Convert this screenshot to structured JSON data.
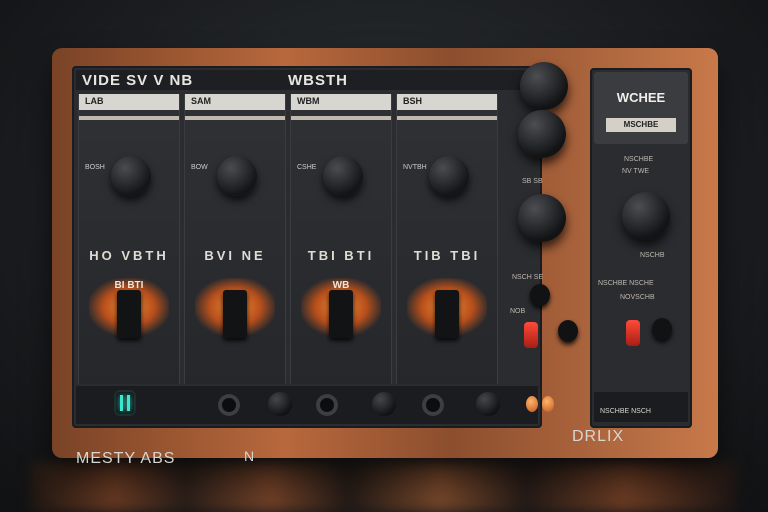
{
  "header": {
    "title_left": "VIDE SV  V  NB",
    "title_right": "WBSTH"
  },
  "channels": [
    {
      "top_label": "LAB",
      "knob_label": "BOSH",
      "readout": "HO  VBTH",
      "glow_label": "BI  BTI"
    },
    {
      "top_label": "SAM",
      "knob_label": "BOW",
      "readout": "BVI  NE",
      "glow_label": ""
    },
    {
      "top_label": "WBM",
      "knob_label": "CSHE",
      "readout": "TBI  BTI",
      "glow_label": "WB"
    },
    {
      "top_label": "BSH",
      "knob_label": "NVTBH",
      "readout": "TIB  TBI",
      "glow_label": ""
    }
  ],
  "side_panel": {
    "title": "WCHEE",
    "subtitle": "MSCHBE",
    "label_1": "NSCHBE",
    "label_2": "NV TWE",
    "label_3": "NSCHB",
    "label_4": "NSCHBE NSCHE",
    "label_5": "NOVSCHB",
    "footer": "NSCHBE NSCH"
  },
  "center_column": {
    "label_1": "SB  SB",
    "label_2": "NSCH  SE",
    "label_3": "NOB"
  },
  "footer": {
    "brand": "MESTY ABS",
    "mid_label": "N",
    "right_label": "DRLIX"
  },
  "colors": {
    "chassis": "#b8683c",
    "faceplate": "#2a2c30",
    "glow": "#ff9a3a",
    "led_teal": "#3ee6d0",
    "button_red": "#ff4a3a"
  }
}
